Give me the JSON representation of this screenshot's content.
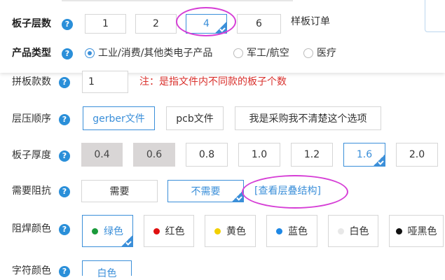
{
  "header": {
    "layers_label": "板子层数",
    "layers_options": [
      "1",
      "2",
      "4",
      "6"
    ],
    "sample_order_text": "样板订单",
    "product_type_label": "产品类型",
    "product_types": [
      "工业/消费/其他类电子产品",
      "军工/航空",
      "医疗"
    ]
  },
  "panel_count": {
    "label": "拼板款数",
    "value": "1",
    "note": "注：是指文件内不同款的板子个数"
  },
  "stack_order": {
    "label": "层压顺序",
    "options": [
      "gerber文件",
      "pcb文件",
      "我是采购我不清楚这个选项"
    ]
  },
  "thickness": {
    "label": "板子厚度",
    "options": [
      "0.4",
      "0.6",
      "0.8",
      "1.0",
      "1.2",
      "1.6",
      "2.0"
    ]
  },
  "impedance": {
    "label": "需要阻抗",
    "options": [
      "需要",
      "不需要"
    ],
    "view_stack_link": "[查看层叠结构]"
  },
  "solder_mask": {
    "label": "阻焊颜色",
    "options": [
      {
        "name": "绿色",
        "color": "#1a9a3a"
      },
      {
        "name": "红色",
        "color": "#e01010"
      },
      {
        "name": "黄色",
        "color": "#f2d000"
      },
      {
        "name": "蓝色",
        "color": "#1e88e5"
      },
      {
        "name": "白色",
        "color": "#e8e8e8"
      },
      {
        "name": "哑黑色",
        "color": "#111111"
      }
    ]
  },
  "silkscreen": {
    "label": "字符颜色",
    "first_option": "白色"
  },
  "colors": {
    "accent": "#3b8fd9",
    "highlight": "#d63fd6",
    "note": "#d9302c"
  }
}
